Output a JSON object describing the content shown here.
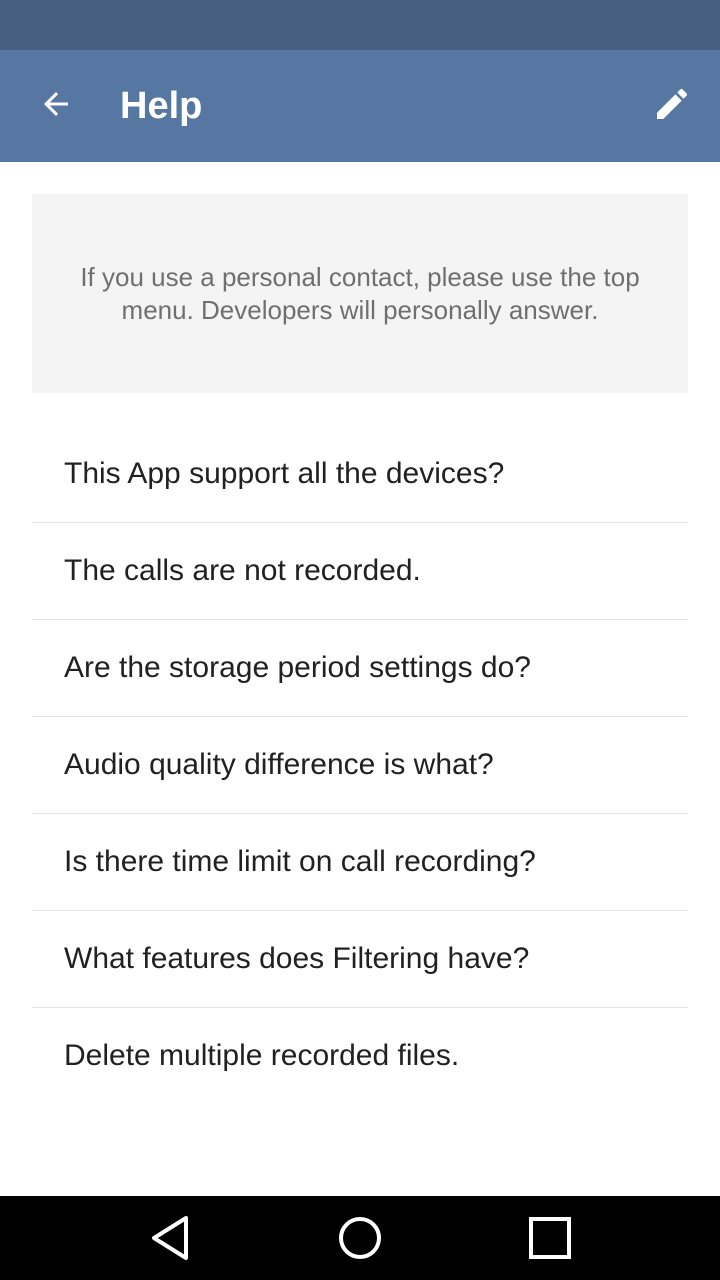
{
  "app_bar": {
    "title": "Help",
    "back_icon": "arrow-back-icon",
    "edit_icon": "pencil-icon",
    "background_color": "#5677a2",
    "status_bar_color": "#475f80"
  },
  "notice": {
    "text": "If you use a personal contact, please use the top menu. Developers will personally answer."
  },
  "faq": {
    "items": [
      {
        "label": "This App support all the devices?"
      },
      {
        "label": "The calls are not recorded."
      },
      {
        "label": "Are the storage period settings do?"
      },
      {
        "label": "Audio quality difference is what?"
      },
      {
        "label": "Is there time limit on call recording?"
      },
      {
        "label": "What features does Filtering have?"
      },
      {
        "label": "Delete multiple recorded files."
      }
    ]
  },
  "nav_bar": {
    "back_icon": "nav-back-triangle-icon",
    "home_icon": "nav-home-circle-icon",
    "recents_icon": "nav-recents-square-icon"
  }
}
